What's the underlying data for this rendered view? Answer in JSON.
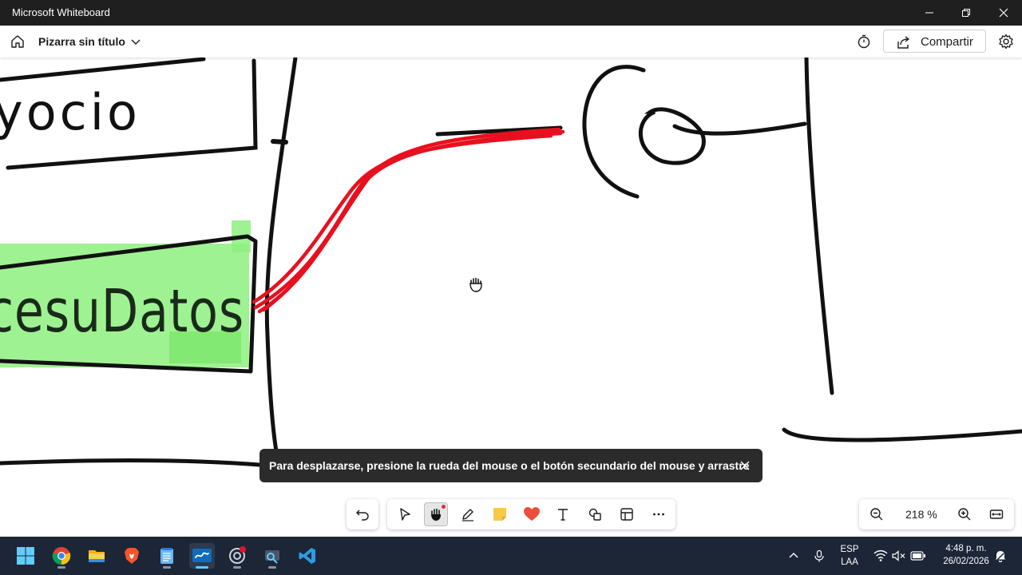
{
  "window": {
    "title": "Microsoft Whiteboard"
  },
  "appbar": {
    "board_title": "Pizarra sin título",
    "share_label": "Compartir"
  },
  "canvas": {
    "texts": [
      "yocio",
      "cesuDatos"
    ],
    "cursor": "hand-grab-icon"
  },
  "toast": {
    "message": "Para desplazarse, presione la rueda del mouse o el botón secundario del mouse y arrastre"
  },
  "toolbar": {
    "tools": [
      "undo-icon",
      "select-icon",
      "hand-icon",
      "pen-icon",
      "sticky-note-icon",
      "reaction-icon",
      "text-icon",
      "shapes-icon",
      "templates-icon",
      "more-icon"
    ],
    "active_tool": "hand-icon"
  },
  "zoom": {
    "level": "218 %"
  },
  "taskbar": {
    "apps": [
      "windows-start-icon",
      "chrome-icon",
      "file-explorer-icon",
      "brave-icon",
      "notepad-icon",
      "whiteboard-icon",
      "app-icon",
      "snipping-tool-icon",
      "vscode-icon"
    ],
    "lang_top": "ESP",
    "lang_bottom": "LAA",
    "time": "4:48 p. m.",
    "date": "26/02/2026"
  },
  "colors": {
    "titlebar": "#1f1f1f",
    "ink_black": "#111111",
    "ink_red": "#e8101e",
    "highlight_green": "#8ef07f",
    "taskbar": "#1c2637",
    "accent": "#60cdff"
  }
}
